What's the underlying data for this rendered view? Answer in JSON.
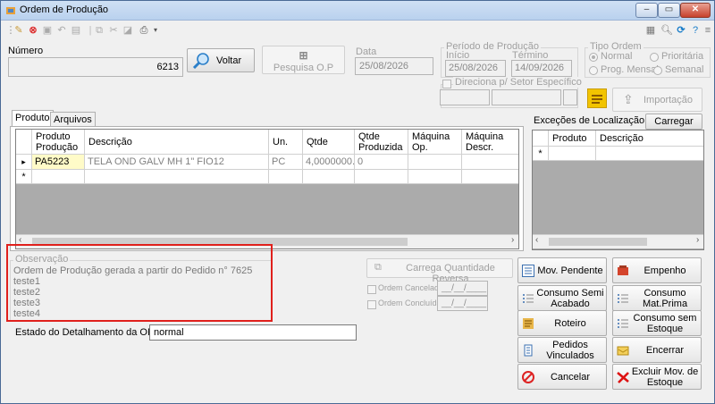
{
  "window": {
    "title": "Ordem de Produção",
    "min": "–",
    "max": "▭",
    "close": "✕"
  },
  "header": {
    "numero_label": "Número",
    "numero_value": "6213",
    "voltar_label": "Voltar",
    "pesquisa_label": "Pesquisa O.P",
    "data_label": "Data",
    "data_value": "25/08/2026",
    "periodo_label": "Período de Produção",
    "inicio_label": "Início",
    "inicio_value": "25/08/2026",
    "termino_label": "Término",
    "termino_value": "14/09/2026",
    "tipo_label": "Tipo Ordem",
    "tipo_options": [
      "Normal",
      "Prioritária",
      "Prog. Mensal",
      "Semanal"
    ],
    "direciona_label": "Direciona p/ Setor Específico",
    "importacao_label": "Importação"
  },
  "tabs": [
    {
      "label": "Produto"
    },
    {
      "label": "Arquivos"
    }
  ],
  "produto_grid": {
    "columns": [
      "Produto Produção",
      "Descrição",
      "Un.",
      "Qtde",
      "Qtde Produzida",
      "Máquina Op.",
      "Máquina Descr."
    ],
    "rows": [
      {
        "marker": "▸",
        "cells": [
          "PA5223",
          "TELA OND GALV MH 1\" FIO12",
          "PC",
          "4,0000000...",
          "0",
          "",
          ""
        ]
      }
    ],
    "new_row_marker": "*"
  },
  "excecoes": {
    "title": "Exceções de Localização",
    "carregar_label": "Carregar",
    "columns": [
      "Produto",
      "Descrição"
    ],
    "new_row_marker": "*"
  },
  "observacao": {
    "label": "Observação",
    "lines": [
      "Ordem de Produção gerada a partir do Pedido n° 7625",
      "teste1",
      "teste2",
      "teste3",
      "teste4"
    ]
  },
  "estado": {
    "label": "Estado do Detalhamento da OP:",
    "value": "normal"
  },
  "middle": {
    "carrega_label": "Carrega Quantidade Reversa",
    "cancelada_label": "Ordem Cancelada",
    "cancelada_date": "__/__/____",
    "concluida_label": "Ordem Concluída",
    "concluida_date": "__/__/____"
  },
  "actions": {
    "mov_pendente": "Mov. Pendente",
    "empenho": "Empenho",
    "consumo_semi": "Consumo Semi Acabado",
    "consumo_mat": "Consumo Mat.Prima",
    "roteiro": "Roteiro",
    "consumo_sem": "Consumo sem Estoque",
    "pedidos": "Pedidos Vinculados",
    "encerrar": "Encerrar",
    "cancelar": "Cancelar",
    "excluir": "Excluir Mov. de Estoque"
  },
  "colors": {
    "highlight_box": "#e0201c",
    "title_bar": "#c6daf2",
    "grid_empty": "#ababab"
  }
}
